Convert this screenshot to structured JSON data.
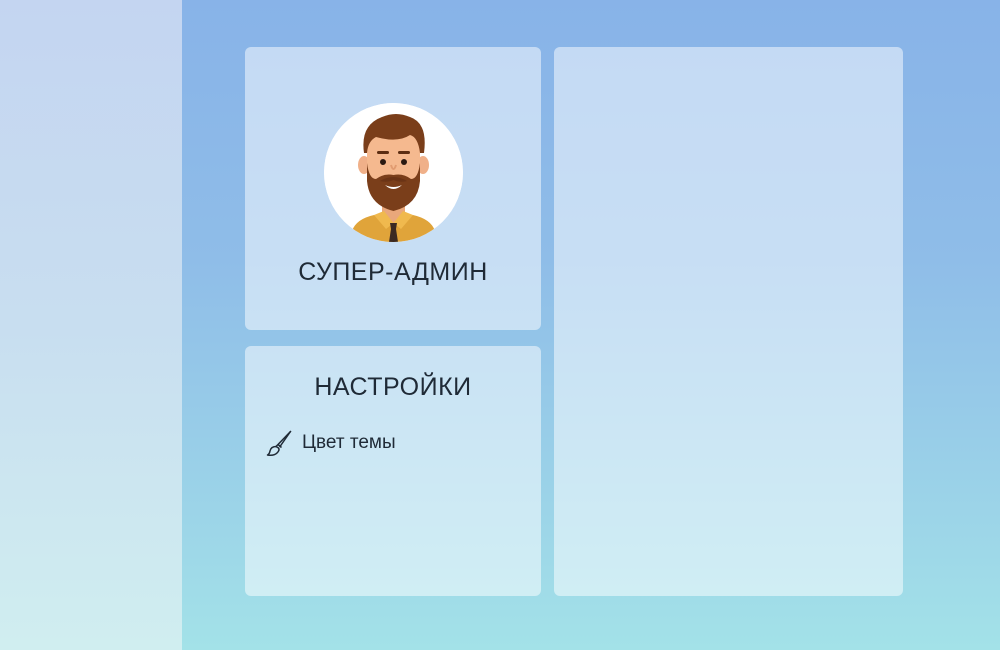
{
  "profile": {
    "role": "СУПЕР-АДМИН",
    "avatar_icon": "bearded-man-avatar"
  },
  "settings": {
    "title": "НАСТРОЙКИ",
    "items": [
      {
        "label": "Цвет темы",
        "icon": "paint-brush-icon"
      }
    ]
  },
  "colors": {
    "background_top": "#88b3e8",
    "background_bottom": "#a3e2e8",
    "sidebar": "#c4d5f1",
    "card": "rgba(255,255,255,0.5)",
    "text": "#1f2a36"
  }
}
